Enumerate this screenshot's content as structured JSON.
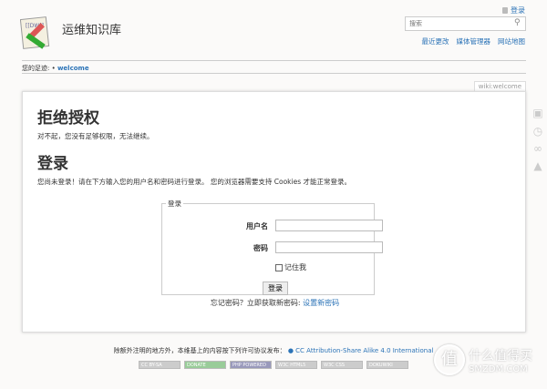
{
  "header": {
    "site_title": "运维知识库",
    "login_link": "登录",
    "search_placeholder": "搜索",
    "tools": [
      "最近更改",
      "媒体管理器",
      "网站地图"
    ]
  },
  "breadcrumb": {
    "label": "您的足迹:",
    "item": "welcome"
  },
  "page_id": "wiki:welcome",
  "content": {
    "denied_heading": "拒绝授权",
    "denied_text": "对不起，您没有足够权限，无法继续。",
    "login_heading": "登录",
    "login_text": "您尚未登录！请在下方输入您的用户名和密码进行登录。 您的浏览器需要支持 Cookies 才能正常登录。",
    "form": {
      "legend": "登录",
      "username_label": "用户名",
      "username_value": "",
      "password_label": "密码",
      "password_value": "",
      "remember_label": "记住我",
      "remember_checked": false,
      "submit_label": "登录"
    },
    "forgot_text": "忘记密码？立即获取新密码:",
    "reset_link": "设置新密码"
  },
  "footer": {
    "license_text": "除额外注明的地方外，本维基上的内容按下列许可协议发布：",
    "license_link": "CC Attribution-Share Alike 4.0 International",
    "badges": [
      "CC BY-SA",
      "DONATE",
      "PHP POWERED",
      "W3C HTML5",
      "W3C CSS",
      "DOKUWIKI"
    ]
  },
  "watermark": {
    "glyph": "值",
    "name": "什么值得买",
    "domain": "SMZDM.COM"
  },
  "colors": {
    "link": "#2b73b7",
    "background": "#fbfaf9"
  }
}
